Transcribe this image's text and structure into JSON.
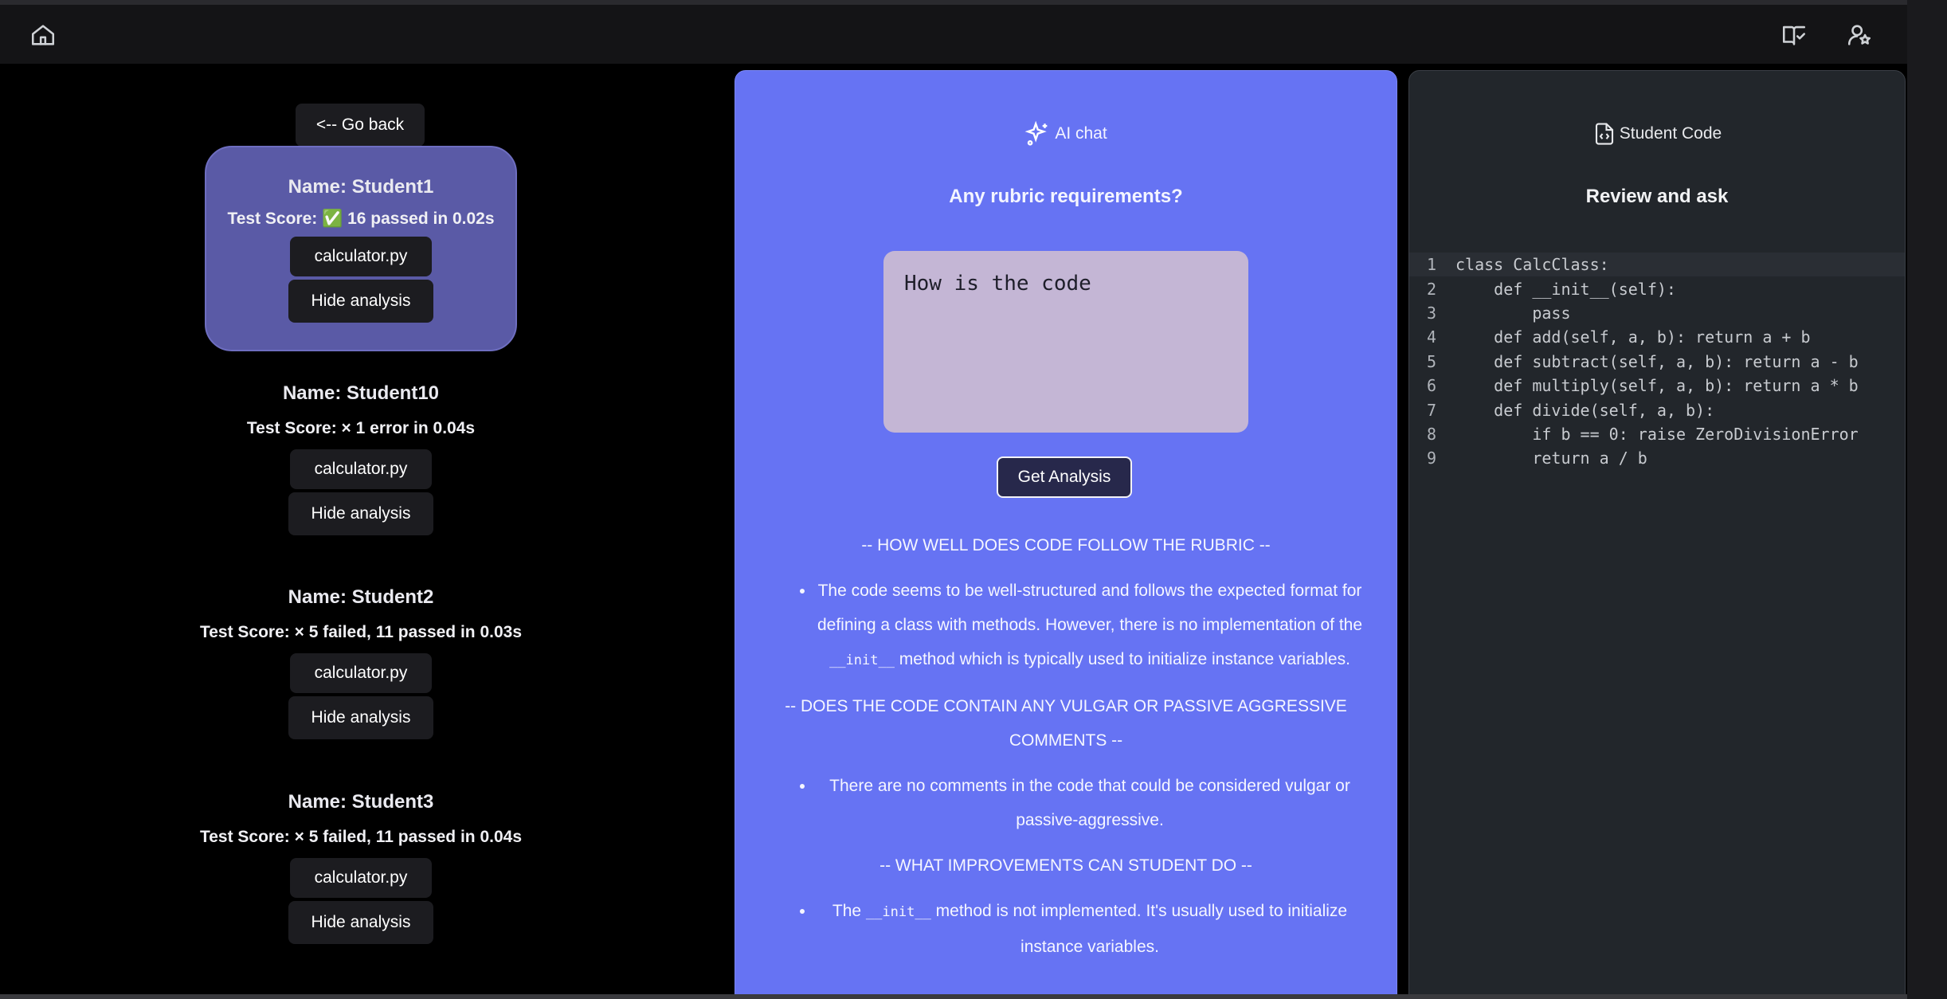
{
  "topbar": {
    "home_icon": "home-icon",
    "book_icon": "book-check-icon",
    "user_icon": "user-star-icon"
  },
  "left": {
    "go_back": "<-- Go back",
    "students": [
      {
        "name": "Name: Student1",
        "score": "Test Score: ✅ 16 passed in 0.02s",
        "file": "calculator.py",
        "toggle": "Hide analysis"
      },
      {
        "name": "Name: Student10",
        "score": "Test Score: × 1 error in 0.04s",
        "file": "calculator.py",
        "toggle": "Hide analysis"
      },
      {
        "name": "Name: Student2",
        "score": "Test Score: × 5 failed, 11 passed in 0.03s",
        "file": "calculator.py",
        "toggle": "Hide analysis"
      },
      {
        "name": "Name: Student3",
        "score": "Test Score: × 5 failed, 11 passed in 0.04s",
        "file": "calculator.py",
        "toggle": "Hide analysis"
      }
    ]
  },
  "middle": {
    "header": "AI chat",
    "title": "Any rubric requirements?",
    "prompt_value": "How is the code",
    "button": "Get Analysis",
    "sections": [
      {
        "heading": "-- HOW WELL DOES CODE FOLLOW THE RUBRIC --"
      },
      {
        "heading": "-- DOES THE CODE CONTAIN ANY VULGAR OR PASSIVE AGGRESSIVE COMMENTS --"
      },
      {
        "heading": "-- WHAT IMPROVEMENTS CAN STUDENT DO --"
      }
    ],
    "bullet1_a": "The code seems to be well-structured and follows the expected format for defining a class with methods. However, there is no implementation of the ",
    "bullet1_code": "__init__",
    "bullet1_b": " method which is typically used to initialize instance variables.",
    "bullet2": "There are no comments in the code that could be considered vulgar or passive-aggressive.",
    "bullet3_a": "The ",
    "bullet3_code": "__init__",
    "bullet3_b": " method is not implemented. It's usually used to initialize instance variables."
  },
  "right": {
    "header": "Student Code",
    "title": "Review and ask",
    "code_lines": [
      "class CalcClass:",
      "    def __init__(self):",
      "        pass",
      "    def add(self, a, b): return a + b",
      "    def subtract(self, a, b): return a - b",
      "    def multiply(self, a, b): return a * b",
      "    def divide(self, a, b):",
      "        if b == 0: raise ZeroDivisionError",
      "        return a / b"
    ],
    "line_numbers": [
      "1",
      "2",
      "3",
      "4",
      "5",
      "6",
      "7",
      "8",
      "9"
    ]
  }
}
